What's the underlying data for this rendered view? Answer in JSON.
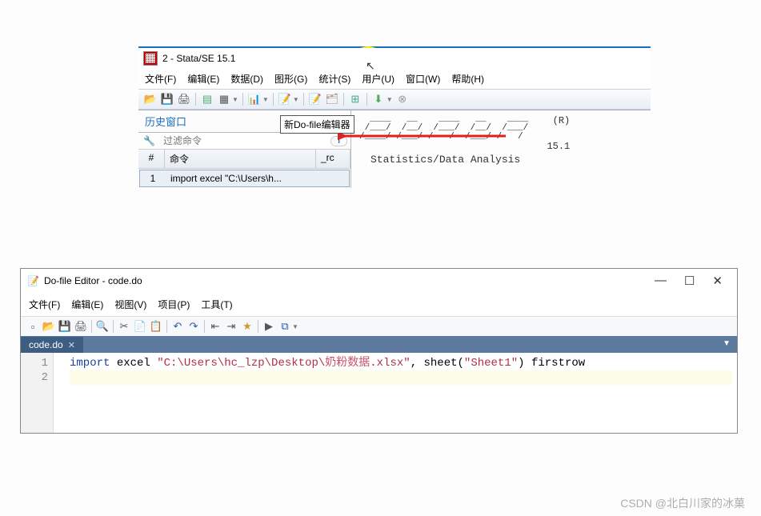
{
  "stata": {
    "title": "2 - Stata/SE 15.1",
    "menu": [
      "文件(F)",
      "编辑(E)",
      "数据(D)",
      "图形(G)",
      "统计(S)",
      "用户(U)",
      "窗口(W)",
      "帮助(H)"
    ],
    "tooltip": "新Do-file编辑器",
    "history": {
      "title": "历史窗口",
      "filter_placeholder": "过滤命令",
      "header": {
        "num": "#",
        "cmd": "命令",
        "rc": "_rc"
      },
      "rows": [
        {
          "num": "1",
          "cmd": "import excel \"C:\\Users\\h...",
          "rc": ""
        }
      ]
    },
    "main": {
      "r_mark": "(R)",
      "version": "15.1",
      "tagline": "Statistics/Data Analysis"
    }
  },
  "dofile": {
    "title": "Do-file Editor - code.do",
    "menu": [
      "文件(F)",
      "编辑(E)",
      "视图(V)",
      "项目(P)",
      "工具(T)"
    ],
    "tab": "code.do",
    "lines": [
      {
        "n": "1",
        "segments": [
          {
            "t": "import",
            "c": "kw"
          },
          {
            "t": " excel ",
            "c": ""
          },
          {
            "t": "\"C:\\Users\\hc_lzp\\Desktop\\",
            "c": "str"
          },
          {
            "t": "奶粉数据",
            "c": "cjk"
          },
          {
            "t": ".xlsx\"",
            "c": "str"
          },
          {
            "t": ", sheet(",
            "c": ""
          },
          {
            "t": "\"Sheet1\"",
            "c": "str"
          },
          {
            "t": ") firstrow",
            "c": ""
          }
        ]
      },
      {
        "n": "2",
        "segments": []
      }
    ]
  },
  "watermark": "CSDN @北白川家的冰菓"
}
